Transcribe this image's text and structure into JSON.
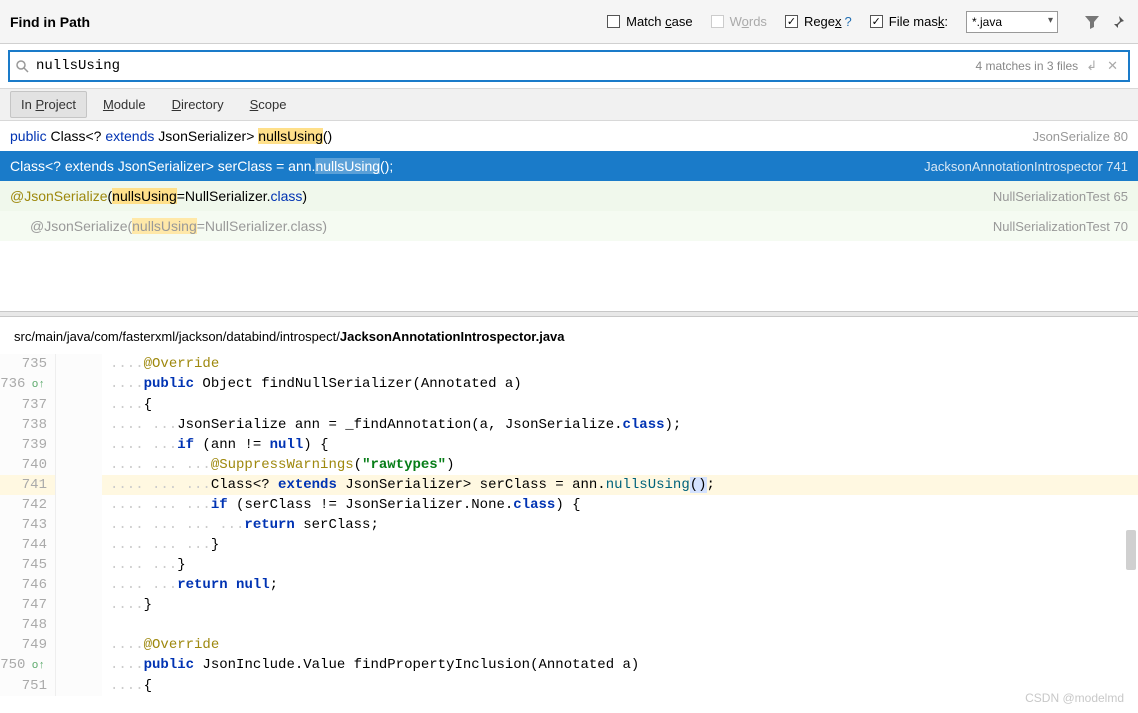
{
  "header": {
    "title": "Find in Path",
    "match_case": {
      "label_pre": "Match ",
      "hot": "c",
      "label_post": "ase",
      "checked": false
    },
    "words": {
      "label_pre": "W",
      "hot": "o",
      "label_post": "rds",
      "disabled": true
    },
    "regex": {
      "label_pre": "Rege",
      "hot": "x",
      "checked": true
    },
    "file_mask": {
      "label_pre": "File mas",
      "hot": "k",
      "label_post": ":",
      "checked": true,
      "value": "*.java"
    }
  },
  "search": {
    "value": "nullsUsing",
    "status": "4 matches in 3 files"
  },
  "tabs": [
    {
      "pre": "In ",
      "hot": "P",
      "post": "roject",
      "active": true
    },
    {
      "pre": "",
      "hot": "M",
      "post": "odule"
    },
    {
      "pre": "",
      "hot": "D",
      "post": "irectory"
    },
    {
      "pre": "",
      "hot": "S",
      "post": "cope"
    }
  ],
  "results": [
    {
      "file": "JsonSerialize",
      "line": "80"
    },
    {
      "file": "JacksonAnnotationIntrospector",
      "line": "741"
    },
    {
      "file": "NullSerializationTest",
      "line": "65"
    },
    {
      "file": "NullSerializationTest",
      "line": "70"
    }
  ],
  "preview": {
    "path_prefix": "src/main/java/com/fasterxml/jackson/databind/introspect/",
    "path_file": "JacksonAnnotationIntrospector.java",
    "lines": {
      "735": "@Override",
      "736": "public Object findNullSerializer(Annotated a)",
      "737": "{",
      "738": "JsonSerialize ann = _findAnnotation(a, JsonSerialize.class);",
      "739": "if (ann != null) {",
      "740": "@SuppressWarnings(\"rawtypes\")",
      "741": "Class<? extends JsonSerializer> serClass = ann.nullsUsing();",
      "742": "if (serClass != JsonSerializer.None.class) {",
      "743": "return serClass;",
      "744": "}",
      "745": "}",
      "746": "return null;",
      "747": "}",
      "748": "",
      "749": "@Override",
      "750": "public JsonInclude.Value findPropertyInclusion(Annotated a)",
      "751": "{"
    }
  },
  "watermark": "CSDN @modelmd",
  "chart_data": null
}
